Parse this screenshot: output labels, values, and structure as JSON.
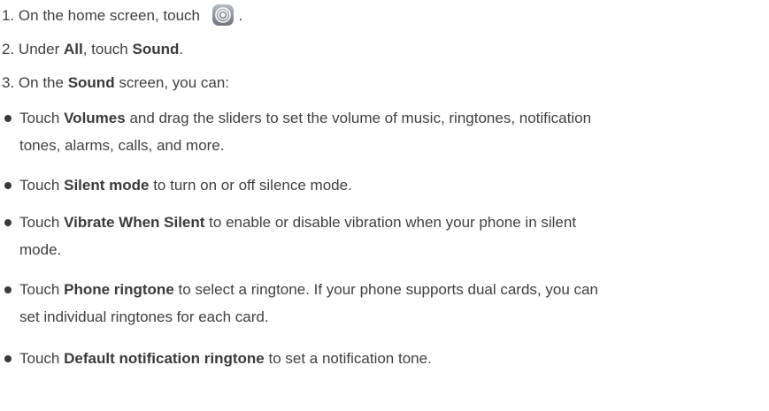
{
  "steps": [
    {
      "num": "1.",
      "pre": "On the home screen, touch",
      "post": "."
    },
    {
      "num": "2.",
      "pre": "Under",
      "b1": "All",
      "mid": ", touch",
      "b2": "Sound",
      "post": "."
    },
    {
      "num": "3.",
      "pre": "On the",
      "b1": "Sound",
      "post": "screen, you can:"
    }
  ],
  "bullets": [
    {
      "pre": "Touch",
      "bold": "Volumes",
      "post": "and drag the sliders to set the volume of music, ringtones, notification",
      "post2": "tones, alarms, calls, and more."
    },
    {
      "pre": "Touch",
      "bold": "Silent mode",
      "post": "to turn on or off silence mode."
    },
    {
      "pre": "Touch",
      "bold": "Vibrate When Silent",
      "post": "to enable or disable vibration when your phone in silent",
      "post2": "mode."
    },
    {
      "pre": "Touch",
      "bold": "Phone ringtone",
      "post": "to select a ringtone. If your phone supports dual cards, you can",
      "post2": "set individual ringtones for each card."
    },
    {
      "pre": "Touch",
      "bold": "Default notification ringtone",
      "post": "to set a notification tone."
    }
  ],
  "icons": {
    "settings": "settings-gear-icon"
  }
}
